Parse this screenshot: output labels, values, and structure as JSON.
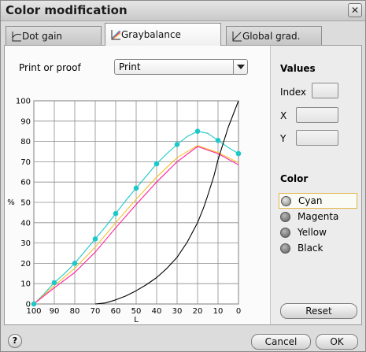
{
  "window": {
    "title": "Color modification",
    "close_glyph": "✕"
  },
  "tabs": [
    {
      "label": "Dot gain",
      "icon": "dot-gain-curve-icon",
      "active": false
    },
    {
      "label": "Graybalance",
      "icon": "graybalance-curve-icon",
      "active": true
    },
    {
      "label": "Global grad.",
      "icon": "global-gradation-curve-icon",
      "active": false
    }
  ],
  "print_or_proof": {
    "label": "Print or proof",
    "value": "Print"
  },
  "values_panel": {
    "heading": "Values",
    "index_label": "Index",
    "index_value": "",
    "x_label": "X",
    "x_value": "",
    "y_label": "Y",
    "y_value": ""
  },
  "color_panel": {
    "heading": "Color",
    "options": [
      {
        "label": "Cyan",
        "selected": true
      },
      {
        "label": "Magenta",
        "selected": false
      },
      {
        "label": "Yellow",
        "selected": false
      },
      {
        "label": "Black",
        "selected": false
      }
    ]
  },
  "buttons": {
    "reset": "Reset",
    "cancel": "Cancel",
    "ok": "OK",
    "help": "?"
  },
  "colors": {
    "cyan": "#1ec8c8",
    "magenta": "#ff1fa0",
    "yellow": "#f3c12c",
    "black": "#000000",
    "selection": "#e2b64a"
  },
  "chart_data": {
    "type": "line",
    "xlabel": "L",
    "ylabel": "%",
    "xlim": [
      100,
      0
    ],
    "ylim": [
      0,
      100
    ],
    "xticks": [
      100,
      90,
      80,
      70,
      60,
      50,
      40,
      30,
      20,
      10,
      0
    ],
    "yticks": [
      0,
      10,
      20,
      30,
      40,
      50,
      60,
      70,
      80,
      90,
      100
    ],
    "grid": true,
    "series": [
      {
        "color": "cyan",
        "x": [
          100,
          95,
          90,
          85,
          80,
          75,
          70,
          65,
          60,
          55,
          50,
          45,
          40,
          35,
          30,
          25,
          20,
          15,
          10,
          5,
          0
        ],
        "y": [
          0,
          5,
          10.5,
          15,
          20,
          26,
          32,
          38,
          44.5,
          51,
          57,
          63,
          69,
          74,
          78.5,
          82.5,
          85,
          84,
          80.5,
          77,
          74
        ],
        "markers": [
          {
            "x": 100,
            "y": 0
          },
          {
            "x": 90,
            "y": 10.5
          },
          {
            "x": 80,
            "y": 20
          },
          {
            "x": 70,
            "y": 32
          },
          {
            "x": 60,
            "y": 44.5
          },
          {
            "x": 50,
            "y": 57
          },
          {
            "x": 40,
            "y": 69
          },
          {
            "x": 30,
            "y": 78.5
          },
          {
            "x": 20,
            "y": 85
          },
          {
            "x": 10,
            "y": 80.5
          },
          {
            "x": 0,
            "y": 74
          }
        ]
      },
      {
        "color": "yellow",
        "x": [
          100,
          90,
          80,
          70,
          60,
          50,
          40,
          30,
          20,
          10,
          0
        ],
        "y": [
          0,
          9,
          17.5,
          28,
          40,
          51.5,
          62.5,
          72,
          78,
          74.5,
          69.5
        ],
        "markers": []
      },
      {
        "color": "magenta",
        "x": [
          100,
          90,
          80,
          70,
          60,
          50,
          40,
          30,
          20,
          10,
          0
        ],
        "y": [
          0,
          8,
          15.5,
          25.5,
          37.5,
          49,
          60,
          70,
          77.5,
          74,
          68.5
        ],
        "markers": []
      },
      {
        "color": "black",
        "x": [
          70,
          65,
          60,
          55,
          50,
          45,
          40,
          35,
          30,
          25,
          20,
          17,
          15,
          12,
          10,
          5,
          0
        ],
        "y": [
          0,
          0.5,
          2,
          4,
          6.5,
          9.5,
          13,
          17.5,
          23,
          30.5,
          40,
          47.5,
          53.5,
          63,
          71,
          87,
          100
        ],
        "markers": []
      }
    ]
  }
}
